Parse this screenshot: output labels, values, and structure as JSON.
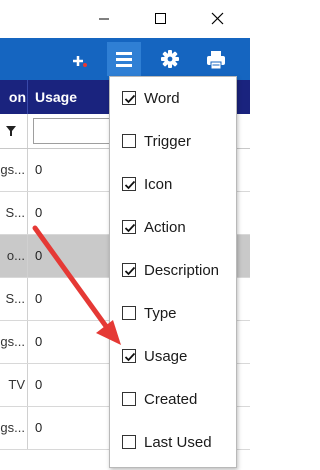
{
  "window_controls": {
    "minimize_icon": "minimize-icon",
    "maximize_icon": "maximize-icon",
    "close_icon": "close-icon"
  },
  "toolbar": {
    "color": "#1565c0",
    "buttons": [
      "add-icon",
      "menu-icon",
      "gear-icon",
      "printer-icon"
    ]
  },
  "grid": {
    "columns": [
      "on",
      "Usage"
    ],
    "rows": [
      {
        "col1": "gs...",
        "usage": "0",
        "selected": false
      },
      {
        "col1": "S...",
        "usage": "0",
        "selected": false
      },
      {
        "col1": "o...",
        "usage": "0",
        "selected": true
      },
      {
        "col1": "S...",
        "usage": "0",
        "selected": false
      },
      {
        "col1": "gs...",
        "usage": "0",
        "selected": false
      },
      {
        "col1": "TV",
        "usage": "0",
        "selected": false
      },
      {
        "col1": "gs...",
        "usage": "0",
        "selected": false
      }
    ]
  },
  "column_menu": {
    "items": [
      {
        "label": "Word",
        "checked": true
      },
      {
        "label": "Trigger",
        "checked": false
      },
      {
        "label": "Icon",
        "checked": true
      },
      {
        "label": "Action",
        "checked": true
      },
      {
        "label": "Description",
        "checked": true
      },
      {
        "label": "Type",
        "checked": false
      },
      {
        "label": "Usage",
        "checked": true
      },
      {
        "label": "Created",
        "checked": false
      },
      {
        "label": "Last Used",
        "checked": false
      }
    ]
  },
  "annotation_arrow_color": "#e53935"
}
